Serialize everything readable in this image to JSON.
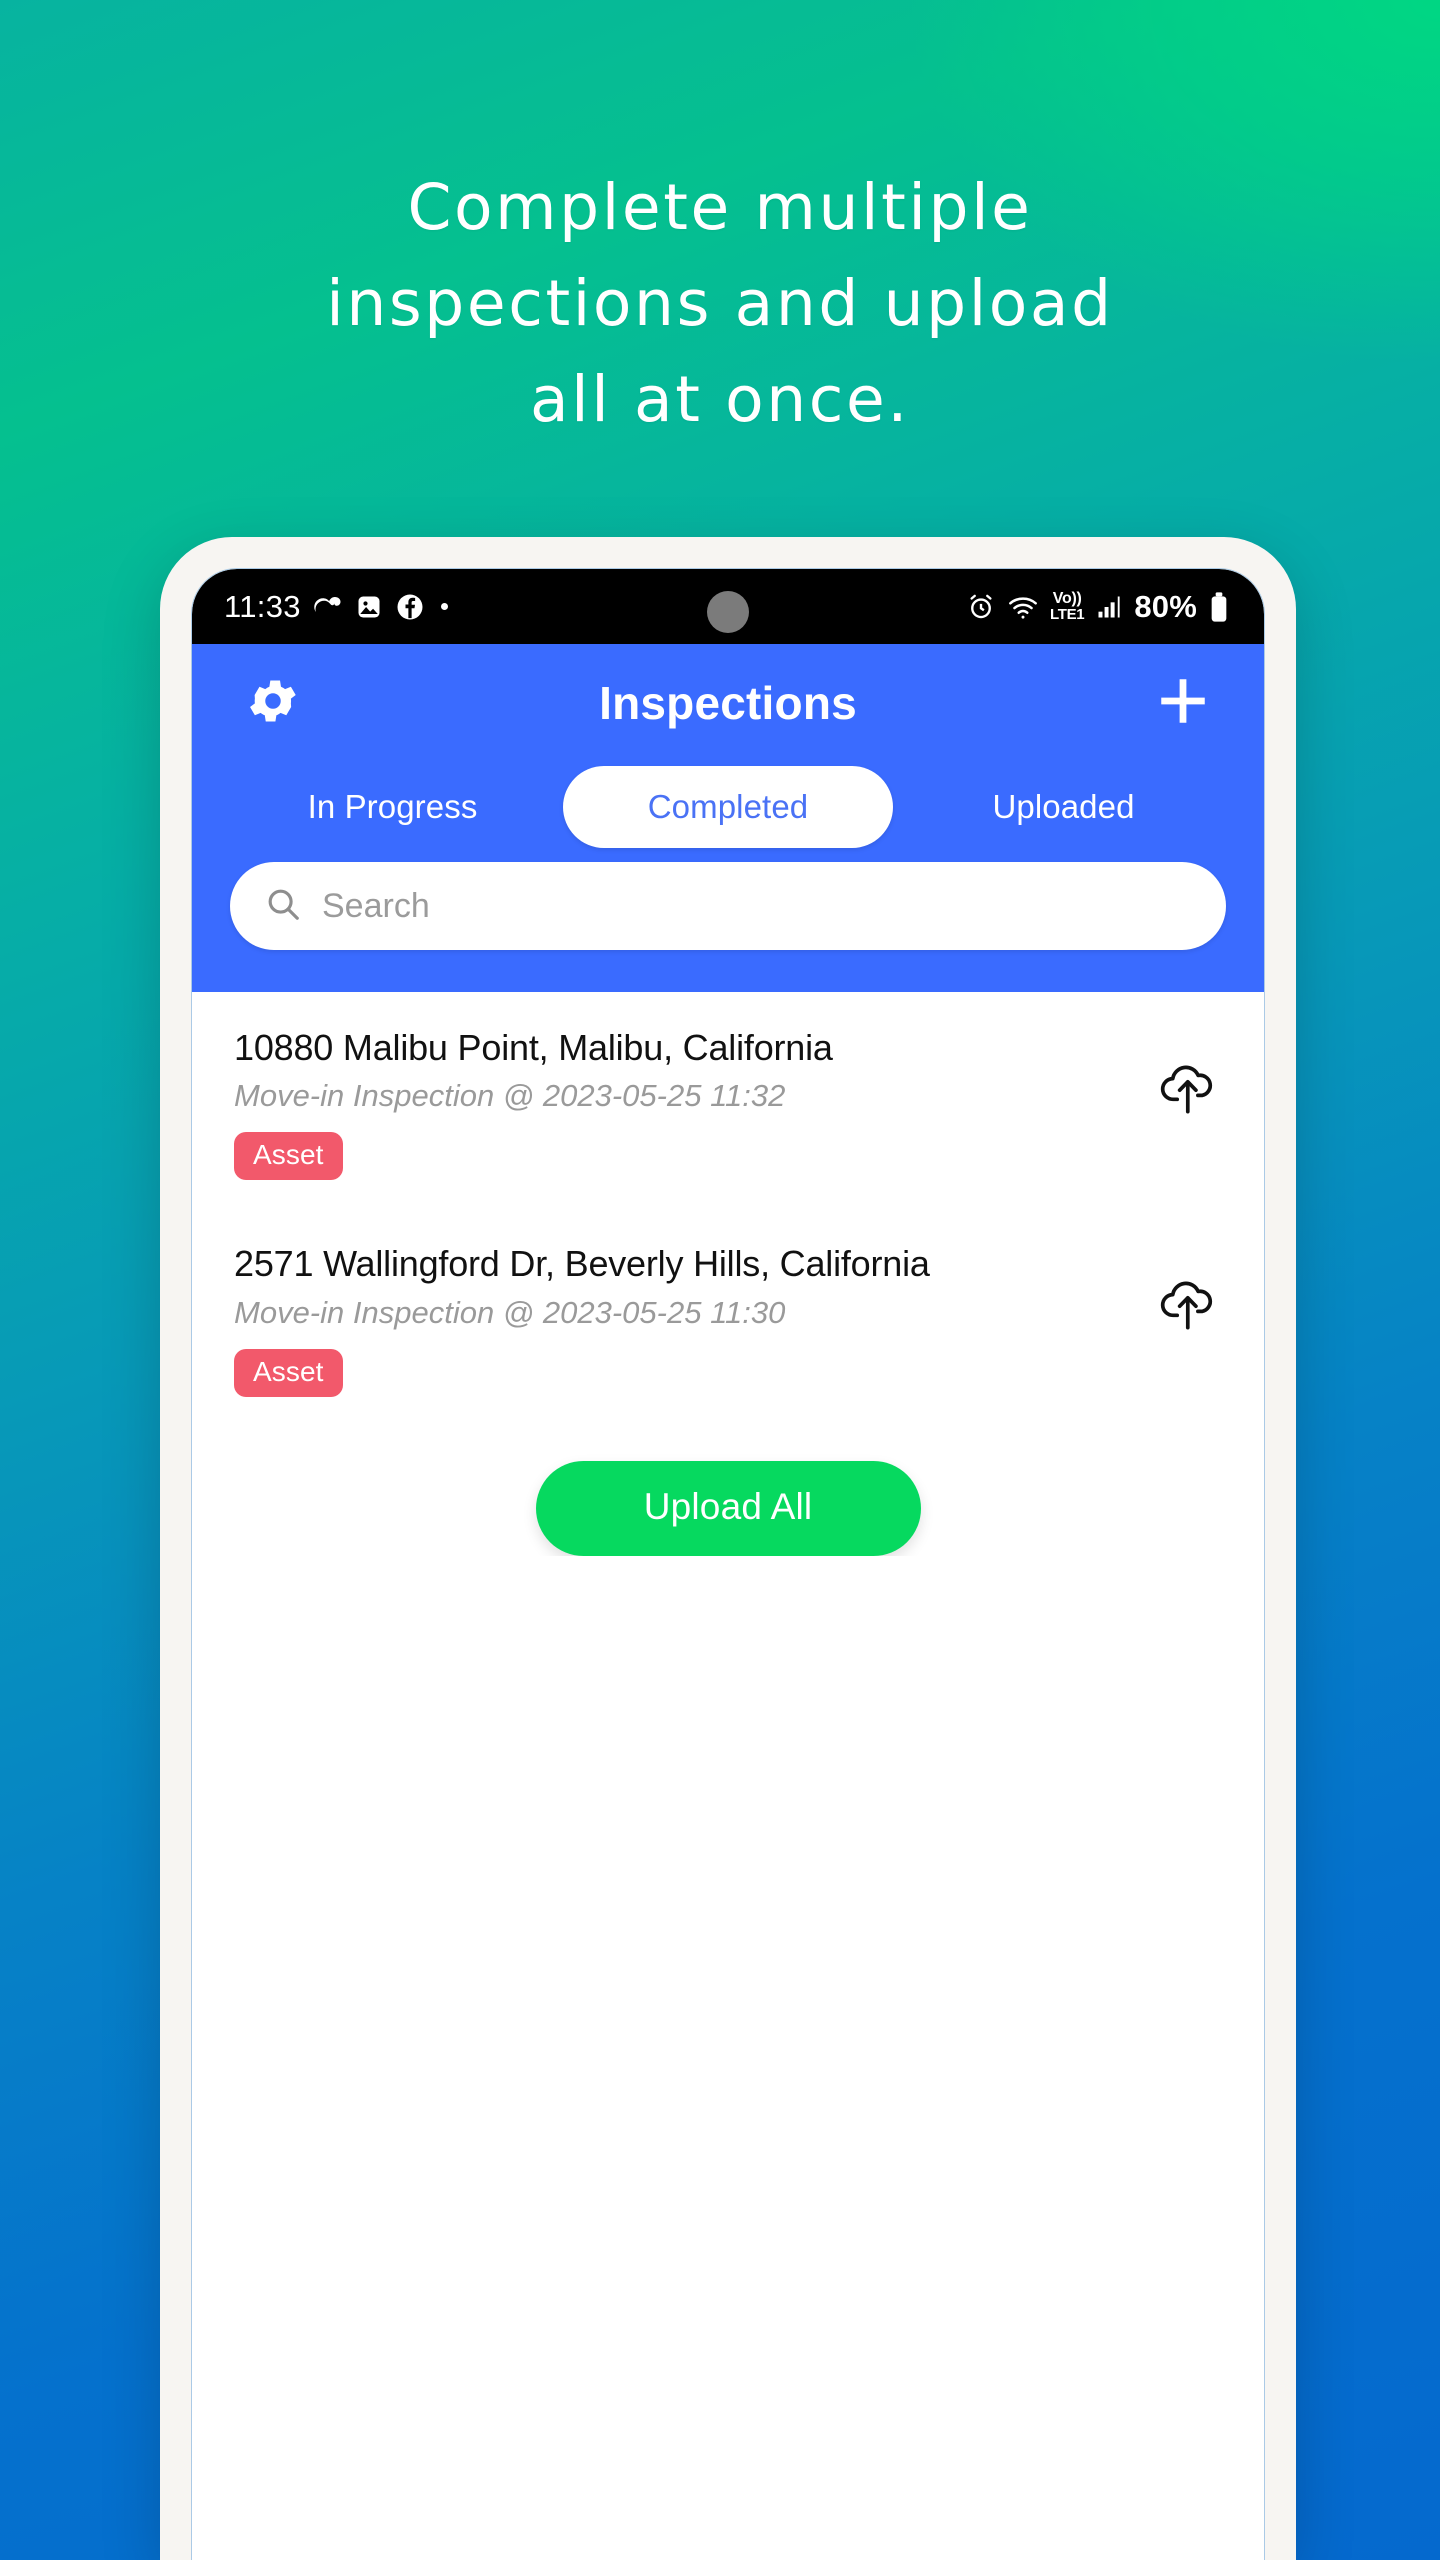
{
  "promo": {
    "headline_lines": [
      "Complete multiple",
      "inspections and upload",
      "all at once."
    ]
  },
  "colors": {
    "bg_top_left": "#06ada3",
    "bg_top_right": "#05c08f",
    "bg_bottom": "#0569ce",
    "appbar_blue": "#3a6bff",
    "tab_active_text": "#4a72f5",
    "badge_red": "#f2596b",
    "upload_green": "#06d95f",
    "phone_frame": "#f7f5f2"
  },
  "status_bar": {
    "time": "11:33",
    "left_icons": [
      "messenger-icon",
      "gallery-icon",
      "facebook-icon",
      "dot-icon"
    ],
    "right_icons": [
      "alarm-icon",
      "wifi-icon",
      "volte-icon",
      "signal-icon",
      "battery-icon"
    ],
    "volte_top": "Vo))",
    "volte_bottom": "LTE1",
    "battery": "80%"
  },
  "app_bar": {
    "settings_icon": "gear-icon",
    "title": "Inspections",
    "add_icon": "plus-icon"
  },
  "tabs": [
    {
      "label": "In Progress",
      "active": false
    },
    {
      "label": "Completed",
      "active": true
    },
    {
      "label": "Uploaded",
      "active": false
    }
  ],
  "search": {
    "icon": "search-icon",
    "placeholder": "Search",
    "value": ""
  },
  "inspections": [
    {
      "address": "10880 Malibu Point, Malibu, California",
      "detail": "Move-in Inspection @ 2023-05-25 11:32",
      "badge": "Asset",
      "action_icon": "cloud-upload-icon"
    },
    {
      "address": "2571 Wallingford Dr, Beverly Hills, California",
      "detail": "Move-in Inspection @ 2023-05-25 11:30",
      "badge": "Asset",
      "action_icon": "cloud-upload-icon"
    }
  ],
  "upload_all": {
    "label": "Upload All"
  }
}
